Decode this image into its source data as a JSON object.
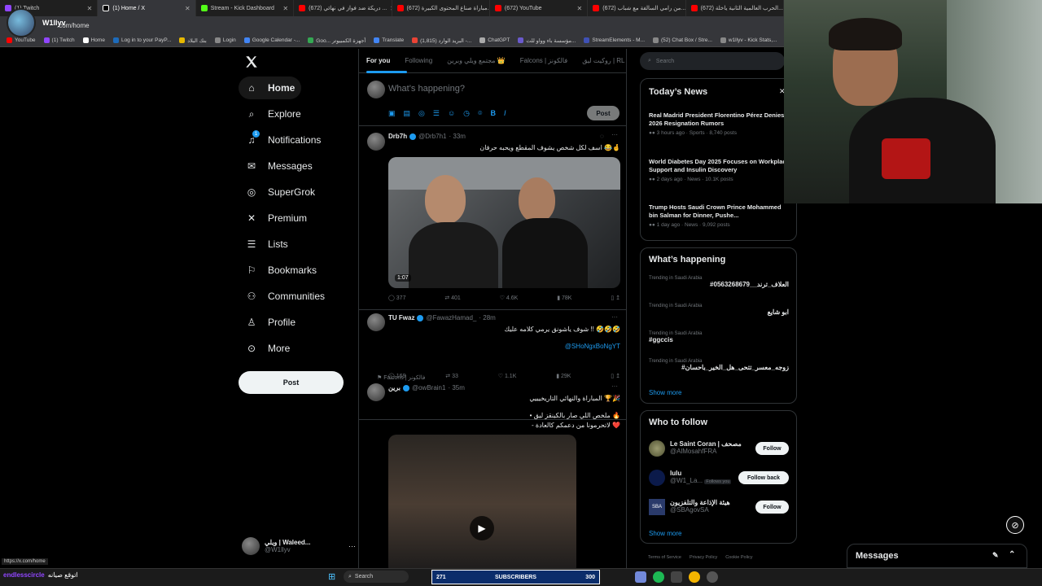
{
  "browser": {
    "tabs": [
      {
        "label": "(1) Twitch",
        "color": "#9146ff"
      },
      {
        "label": "(1) Home / X",
        "color": "#ffffff",
        "active": true
      },
      {
        "label": "Stream - Kick Dashboard",
        "color": "#53fc18"
      },
      {
        "label": "(672) دريكة ضد فواز في نهائي ...",
        "color": "#ff0000"
      },
      {
        "label": "(672) مباراة صناع المحتوى الكبيرة...",
        "color": "#ff0000"
      },
      {
        "label": "(672) YouTube",
        "color": "#ff0000"
      },
      {
        "label": "(672) من رامي السالفة مع شباب...",
        "color": "#ff0000"
      },
      {
        "label": "(672) الحرب العالمية الثانية ياخلة...",
        "color": "#ff0000"
      }
    ],
    "address": ".com/home",
    "profile_name": "W1llyv",
    "bookmarks": [
      {
        "label": "YouTube",
        "color": "#ff0000"
      },
      {
        "label": "(1) Twitch",
        "color": "#9146ff"
      },
      {
        "label": "Home",
        "color": "#ffffff"
      },
      {
        "label": "Log in to your PayP...",
        "color": "#1d6bbb"
      },
      {
        "label": "بنك البلاد",
        "color": "#e6b800"
      },
      {
        "label": "Login",
        "color": "#888888"
      },
      {
        "label": "Google Calendar -...",
        "color": "#4285f4"
      },
      {
        "label": "Goo... أجهزة الكمبيوتر",
        "color": "#34a853"
      },
      {
        "label": "Translate",
        "color": "#4285f4"
      },
      {
        "label": "(1,815) البريد الوارد -...",
        "color": "#ea4335"
      },
      {
        "label": "ChatGPT",
        "color": "#aaaaaa"
      },
      {
        "label": "مؤسسة باء وواو للت...",
        "color": "#6a5acd"
      },
      {
        "label": "StreamElements - M...",
        "color": "#3f51b5"
      },
      {
        "label": "(52) Chat Box / Stre...",
        "color": "#888888"
      },
      {
        "label": "w1llyv - Kick Stats,...",
        "color": "#888888"
      },
      {
        "label": "Kick",
        "color": "#53fc18"
      }
    ],
    "status_url": "https://x.com/home"
  },
  "nav": {
    "items": [
      {
        "label": "Home",
        "icon": "home-icon"
      },
      {
        "label": "Explore",
        "icon": "search-icon"
      },
      {
        "label": "Notifications",
        "icon": "bell-icon",
        "badge": "1"
      },
      {
        "label": "Messages",
        "icon": "envelope-icon"
      },
      {
        "label": "SuperGrok",
        "icon": "grok-icon"
      },
      {
        "label": "Premium",
        "icon": "x-logo-icon"
      },
      {
        "label": "Lists",
        "icon": "list-icon"
      },
      {
        "label": "Bookmarks",
        "icon": "bookmark-icon"
      },
      {
        "label": "Communities",
        "icon": "people-icon"
      },
      {
        "label": "Profile",
        "icon": "person-icon"
      },
      {
        "label": "More",
        "icon": "more-circle-icon"
      }
    ],
    "post_label": "Post",
    "account": {
      "name": "ويلي | Waleed...",
      "handle": "@W1llyv"
    }
  },
  "timeline": {
    "tabs": [
      "For you",
      "Following",
      "مجتمع ويلي وبرين 👑",
      "Falcons | فالكونز",
      "روكيت ليق | RL"
    ],
    "composer_placeholder": "What’s happening?",
    "composer_post": "Post",
    "tweets": [
      {
        "name": "Drb7h",
        "handle": "@Drb7h1",
        "time": "· 33m",
        "text": "اسف لكل شخص يشوف المقطع ويحبه حرفان 😂🤞",
        "video_time": "1:07",
        "replies": "377",
        "reposts": "401",
        "likes": "4.6K",
        "views": "78K"
      },
      {
        "name": "TU Fwaz",
        "handle": "@FawazHamad_",
        "time": "· 28m",
        "text": "شوف ياشونق يرمي كلامه عليك !! 🤣🤣🤣",
        "link": "@SHoNgxBoNgYT",
        "replies": "169",
        "reposts": "33",
        "likes": "1.1K",
        "views": "29K"
      },
      {
        "context": "Falcons | فالكونز",
        "name": "برين",
        "handle": "@owBrain1",
        "time": "· 35m",
        "text": "المباراة والنهائي التاريخيييي 🏆🎉",
        "line2": "• ملخص اللي صار بالكينقز ليق 🔥",
        "line3": "- لاتحرمونا من دعمكم كالعادة ❤️"
      }
    ]
  },
  "sidebar": {
    "search_placeholder": "Search",
    "news_title": "Today’s News",
    "news": [
      {
        "headline": "Real Madrid President Florentino Pérez Denies 2026 Resignation Rumors",
        "meta": "3 hours ago · Sports · 8,740 posts"
      },
      {
        "headline": "World Diabetes Day 2025 Focuses on Workplace Support and Insulin Discovery",
        "meta": "2 days ago · News · 10.1K posts"
      },
      {
        "headline": "Trump Hosts Saudi Crown Prince Mohammed bin Salman for Dinner, Pushe...",
        "meta": "1 day ago · News · 9,092 posts"
      }
    ],
    "happening_title": "What’s happening",
    "trends": [
      {
        "context": "Trending in Saudi Arabia",
        "name": "#العلاف_ترند__0563268679"
      },
      {
        "context": "Trending in Saudi Arabia",
        "name": "ابو شايع"
      },
      {
        "context": "Trending in Saudi Arabia",
        "name": "#ggccis"
      },
      {
        "context": "Trending in Saudi Arabia",
        "name": "#زوجه_معسر_تتحى_هل_الخير_باحسان"
      }
    ],
    "show_more": "Show more",
    "follow_title": "Who to follow",
    "follow": [
      {
        "name": "Le Saint Coran | مصحف",
        "handle": "@AlMosahfFRA",
        "button": "Follow"
      },
      {
        "name": "lulu",
        "handle": "@W1_La...",
        "extra": "Follows you",
        "button": "Follow back"
      },
      {
        "name": "هيئة الإذاعة والتلفزيون",
        "handle": "@SBAgovSA",
        "button": "Follow"
      }
    ],
    "footer": [
      "Terms of Service",
      "Privacy Policy",
      "Cookie Policy"
    ]
  },
  "messages_drawer": "Messages",
  "overlay": {
    "subs_left": "271",
    "subs_label": "SUBSCRIBERS",
    "subs_right": "300",
    "chat_user": "endlesscircle",
    "chat_text": "اتوقع صيانه",
    "taskbar_search": "Search"
  }
}
